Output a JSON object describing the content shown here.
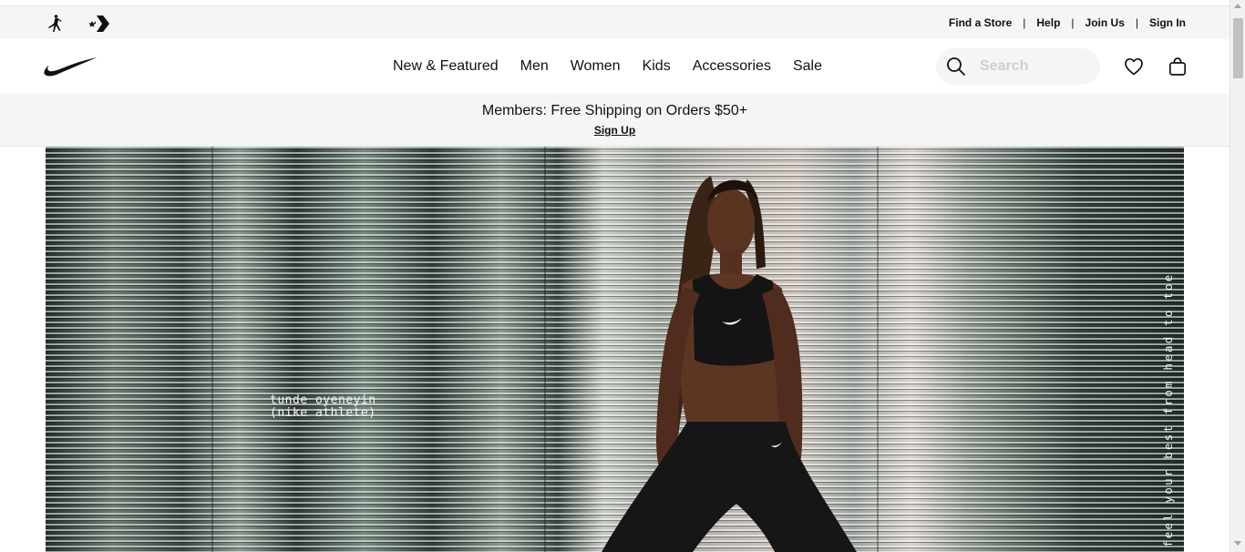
{
  "utility_bar": {
    "brands": [
      {
        "name": "jordan-jumpman-icon"
      },
      {
        "name": "converse-chevron-star-icon"
      }
    ],
    "links": [
      "Find a Store",
      "Help",
      "Join Us",
      "Sign In"
    ],
    "separator": "|"
  },
  "nav": {
    "logo_icon": "nike-swoosh-icon",
    "menu": [
      "New & Featured",
      "Men",
      "Women",
      "Kids",
      "Accessories",
      "Sale"
    ],
    "search": {
      "placeholder": "Search",
      "value": "",
      "icon": "search-icon"
    },
    "favorites_icon": "heart-icon",
    "bag_icon": "shopping-bag-icon"
  },
  "promo": {
    "title": "Members: Free Shipping on Orders $50+",
    "link": "Sign Up"
  },
  "hero": {
    "caption_left_line1": "tunde oyeneyin",
    "caption_left_line2": "(nike athlete)",
    "caption_right": "feel your best from head to toe"
  },
  "colors": {
    "utility_bg": "#f5f5f5",
    "text": "#111111",
    "search_bg": "#f5f5f5",
    "hero_text": "#f2f2f2"
  }
}
